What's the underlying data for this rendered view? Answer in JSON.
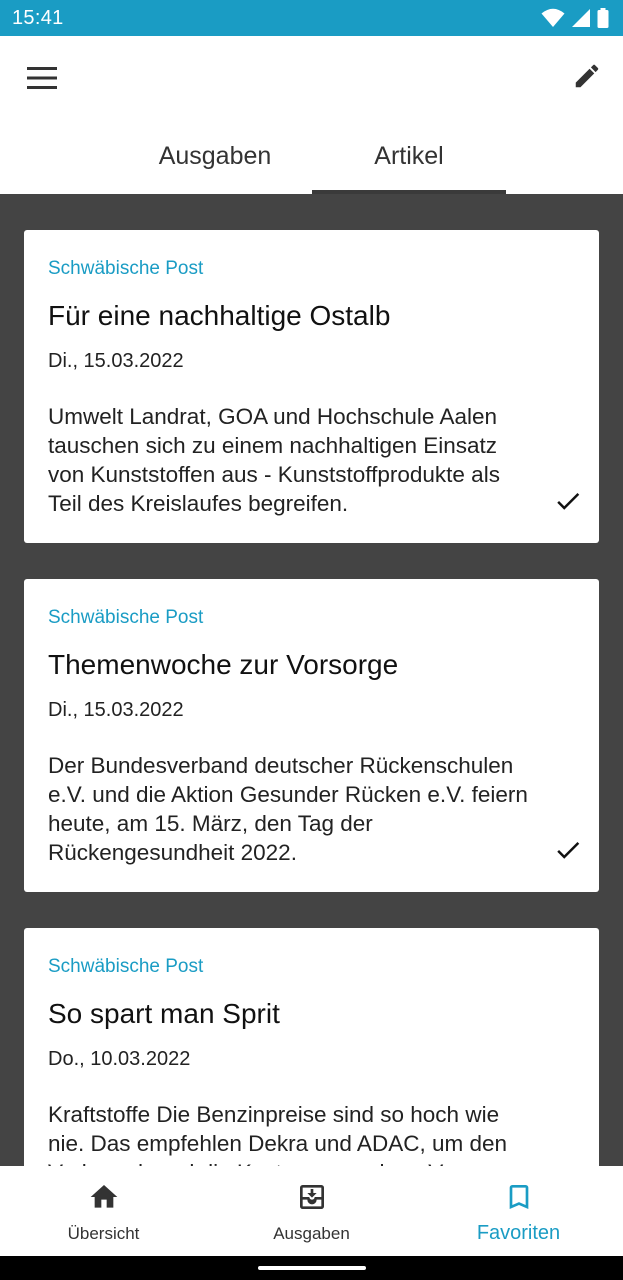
{
  "status_bar": {
    "time": "15:41"
  },
  "tabs": [
    {
      "label": "Ausgaben",
      "active": false
    },
    {
      "label": "Artikel",
      "active": true
    }
  ],
  "articles": [
    {
      "source": "Schwäbische Post",
      "title": "Für eine nachhaltige Ostalb",
      "date": "Di., 15.03.2022",
      "teaser": "Umwelt Landrat, GOA und Hochschule Aalen tauschen sich zu einem nachhaltigen Einsatz von Kunststoffen aus - Kunststoffprodukte als Teil des Kreislaufes begreifen.",
      "read": true
    },
    {
      "source": "Schwäbische Post",
      "title": "Themenwoche zur Vorsorge",
      "date": "Di., 15.03.2022",
      "teaser": "Der Bundesverband deutscher Rückenschulen e.V. und die Aktion Gesunder Rücken e.V. feiern heute, am 15. März, den Tag der Rückengesundheit 2022.",
      "read": true
    },
    {
      "source": "Schwäbische Post",
      "title": "So spart man Sprit",
      "date": "Do., 10.03.2022",
      "teaser": "Kraftstoffe Die Benzinpreise sind so hoch wie nie. Das empfehlen Dekra und ADAC, um den Verbrauch und die Kosten zu senken. Von",
      "read": false
    }
  ],
  "bottom_nav": [
    {
      "label": "Übersicht",
      "icon": "home-icon",
      "active": false
    },
    {
      "label": "Ausgaben",
      "icon": "archive-icon",
      "active": false
    },
    {
      "label": "Favoriten",
      "icon": "bookmark-icon",
      "active": true
    }
  ],
  "colors": {
    "accent": "#1a9cc4",
    "content_background": "#444444",
    "card_background": "#ffffff"
  }
}
